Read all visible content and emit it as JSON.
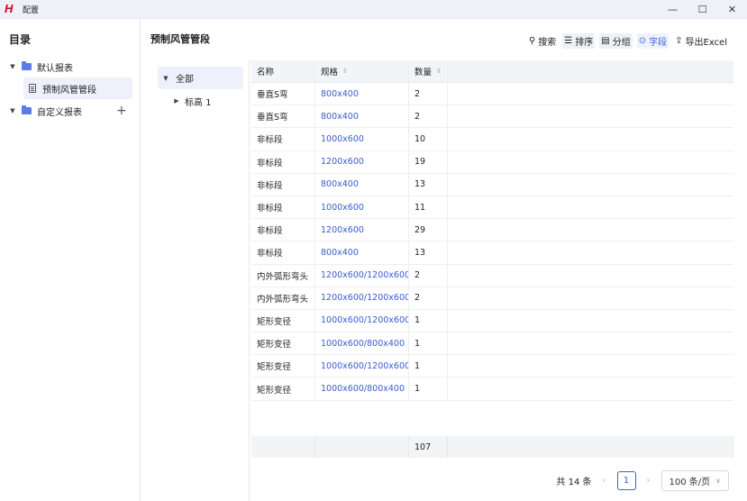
{
  "app": {
    "logo": "H",
    "title": "配置"
  },
  "window": {
    "minimize": "—",
    "maximize": "☐",
    "close": "✕"
  },
  "sidebar": {
    "title": "目录",
    "items": [
      {
        "label": "默认报表"
      },
      {
        "label": "预制风管管段"
      },
      {
        "label": "自定义报表"
      }
    ],
    "add_icon": "+"
  },
  "main": {
    "title": "预制风管管段",
    "toolbar": {
      "search": "搜索",
      "sort": "排序",
      "group": "分组",
      "fields": "字段",
      "export": "导出Excel"
    }
  },
  "groups": {
    "all": "全部",
    "sub": "标高 1"
  },
  "table": {
    "headers": [
      "名称",
      "规格",
      "数量"
    ],
    "rows": [
      [
        "垂直S弯",
        "800x400",
        "2"
      ],
      [
        "垂直S弯",
        "800x400",
        "2"
      ],
      [
        "非标段",
        "1000x600",
        "10"
      ],
      [
        "非标段",
        "1200x600",
        "19"
      ],
      [
        "非标段",
        "800x400",
        "13"
      ],
      [
        "非标段",
        "1000x600",
        "11"
      ],
      [
        "非标段",
        "1200x600",
        "29"
      ],
      [
        "非标段",
        "800x400",
        "13"
      ],
      [
        "内外弧形弯头",
        "1200x600/1200x600",
        "2"
      ],
      [
        "内外弧形弯头",
        "1200x600/1200x600",
        "2"
      ],
      [
        "矩形变径",
        "1000x600/1200x600",
        "1"
      ],
      [
        "矩形变径",
        "1000x600/800x400",
        "1"
      ],
      [
        "矩形变径",
        "1000x600/1200x600",
        "1"
      ],
      [
        "矩形变径",
        "1000x600/800x400",
        "1"
      ]
    ],
    "total": "107"
  },
  "pagination": {
    "summary": "共 14 条",
    "current": "1",
    "page_size": "100 条/页"
  }
}
